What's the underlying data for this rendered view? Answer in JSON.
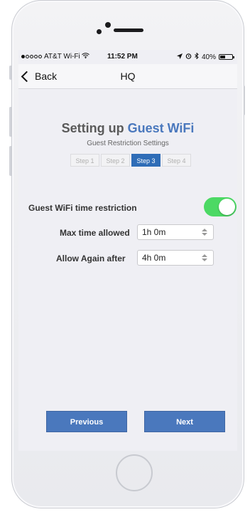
{
  "status": {
    "carrier": "AT&T Wi-Fi",
    "time": "11:52 PM",
    "battery": "40%"
  },
  "nav": {
    "back_label": "Back",
    "title": "HQ"
  },
  "page": {
    "title_main": "Setting up ",
    "title_accent": "Guest WiFi",
    "subtitle": "Guest Restriction Settings",
    "steps": [
      "Step 1",
      "Step 2",
      "Step 3",
      "Step 4"
    ],
    "active_step": 3
  },
  "settings": {
    "restriction_label": "Guest WiFi time restriction",
    "restriction_on": true,
    "max_time_label": "Max time allowed",
    "max_time_value": "1h 0m",
    "allow_again_label": "Allow Again after",
    "allow_again_value": "4h 0m"
  },
  "buttons": {
    "previous": "Previous",
    "next": "Next"
  },
  "colors": {
    "accent": "#4a78bd",
    "toggle_on": "#4cd964",
    "active_step": "#2f6db7"
  }
}
